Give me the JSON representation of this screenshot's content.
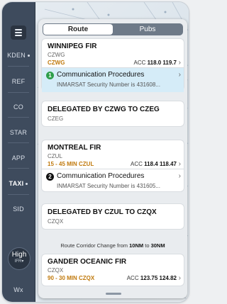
{
  "sidebar": {
    "items": [
      {
        "label": "KDEN",
        "dot": true,
        "active": false
      },
      {
        "label": "REF",
        "dot": false,
        "active": false
      },
      {
        "label": "CO",
        "dot": false,
        "active": false
      },
      {
        "label": "STAR",
        "dot": false,
        "active": false
      },
      {
        "label": "APP",
        "dot": false,
        "active": false
      },
      {
        "label": "TAXI",
        "dot": true,
        "active": true
      },
      {
        "label": "SID",
        "dot": false,
        "active": false
      }
    ],
    "high_button": {
      "label": "High",
      "sub": "IFR▾"
    },
    "wx_label": "Wx"
  },
  "tabs": [
    {
      "label": "Route",
      "selected": true
    },
    {
      "label": "Pubs",
      "selected": false
    }
  ],
  "cards": [
    {
      "title": "WINNIPEG FIR",
      "code": "CZWG",
      "orange": "CZWG",
      "freq_prefix": "ACC",
      "freq": "118.0 119.7"
    },
    {
      "title": "DELEGATED BY CZWG TO CZEG",
      "code": "CZEG"
    },
    {
      "title": "MONTREAL FIR",
      "code": "CZUL",
      "orange": "15 - 45 MIN CZUL",
      "freq_prefix": "ACC",
      "freq": "118.4 118.47"
    },
    {
      "title": "DELEGATED BY CZUL TO CZQX",
      "code": "CZQX"
    },
    {
      "title": "GANDER OCEANIC FIR",
      "code": "CZQX",
      "orange": "90 - 30 MIN CZQX",
      "freq_prefix": "ACC",
      "freq": "123.75 124.82"
    }
  ],
  "comm": [
    {
      "num": "1",
      "title": "Communication Procedures",
      "sub": "INMARSAT Security Number is 431608...",
      "highlighted": true,
      "badge_color": "#2e9e4a"
    },
    {
      "num": "2",
      "title": "Communication Procedures",
      "sub": "INMARSAT Security Number is 431605...",
      "highlighted": false,
      "badge_color": "#111111"
    }
  ],
  "route_note": {
    "prefix": "Route Corridor Change from",
    "from": "10NM",
    "mid": "to",
    "to": "30NM"
  }
}
